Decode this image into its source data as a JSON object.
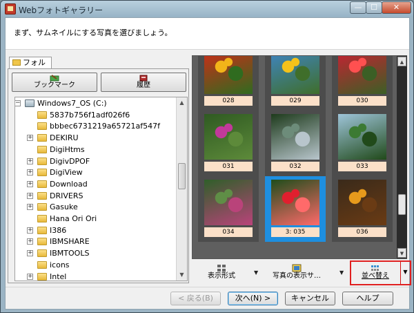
{
  "window": {
    "title": "Webフォトギャラリー",
    "min": "—",
    "max": "☐",
    "close": "✕"
  },
  "instruction": "まず、サムネイルにする写真を選びましょう。",
  "folder_tab": "フォルダ",
  "nav": {
    "bookmark": "ブックマーク",
    "history": "履歴"
  },
  "tree": [
    {
      "label": "Windows7_OS (C:)",
      "kind": "drive",
      "expand": "−"
    },
    {
      "label": "5837b756f1adf026f6",
      "kind": "folder",
      "expand": ""
    },
    {
      "label": "bbbec6731219a65721af547f",
      "kind": "folder",
      "expand": ""
    },
    {
      "label": "DEKIRU",
      "kind": "folder",
      "expand": "+"
    },
    {
      "label": "DigiHtms",
      "kind": "folder",
      "expand": ""
    },
    {
      "label": "DigivDPOF",
      "kind": "folder",
      "expand": "+"
    },
    {
      "label": "DigiView",
      "kind": "folder",
      "expand": "+"
    },
    {
      "label": "Download",
      "kind": "folder",
      "expand": "+"
    },
    {
      "label": "DRIVERS",
      "kind": "folder",
      "expand": "+"
    },
    {
      "label": "Gasuke",
      "kind": "folder",
      "expand": "+"
    },
    {
      "label": "Hana Ori Ori",
      "kind": "folder",
      "expand": ""
    },
    {
      "label": "I386",
      "kind": "folder",
      "expand": "+"
    },
    {
      "label": "IBMSHARE",
      "kind": "folder",
      "expand": "+"
    },
    {
      "label": "IBMTOOLS",
      "kind": "folder",
      "expand": "+"
    },
    {
      "label": "icons",
      "kind": "folder",
      "expand": ""
    },
    {
      "label": "Intel",
      "kind": "folder",
      "expand": "+"
    }
  ],
  "thumbnails": [
    {
      "caption": "028",
      "selected": false,
      "colors": [
        "#d22a18",
        "#f2b419",
        "#2f6b1f"
      ]
    },
    {
      "caption": "029",
      "selected": false,
      "colors": [
        "#3f86c8",
        "#f4c21a",
        "#3f6e2a"
      ]
    },
    {
      "caption": "030",
      "selected": false,
      "colors": [
        "#cc1f33",
        "#ff5050",
        "#3b5f25"
      ]
    },
    {
      "caption": "031",
      "selected": false,
      "colors": [
        "#2f5a22",
        "#c2399b",
        "#5d8a3a"
      ]
    },
    {
      "caption": "032",
      "selected": false,
      "colors": [
        "#1e3b1c",
        "#6d8c7a",
        "#b8c5cc"
      ]
    },
    {
      "caption": "033",
      "selected": false,
      "colors": [
        "#9ec4d9",
        "#3c7a33",
        "#214a1a"
      ]
    },
    {
      "caption": "034",
      "selected": false,
      "colors": [
        "#2f5f29",
        "#5f8e46",
        "#b9437a"
      ]
    },
    {
      "caption": "3: 035",
      "selected": true,
      "colors": [
        "#1f4d1b",
        "#e11f2e",
        "#ff6a6a"
      ]
    },
    {
      "caption": "036",
      "selected": false,
      "colors": [
        "#3a2a1a",
        "#e79a1c",
        "#6a3b14"
      ]
    }
  ],
  "gallery_tools": {
    "view_style": "表示形式",
    "photo_display": "写真の表示サ…",
    "sort": "並べ替え"
  },
  "footer": {
    "back": "< 戻る(B)",
    "next": "次へ(N) >",
    "cancel": "キャンセル",
    "help": "ヘルプ"
  },
  "colors": {
    "highlight": "#e02020",
    "selection": "#1e8fe0",
    "caption_bg": "#fbe0c8"
  }
}
